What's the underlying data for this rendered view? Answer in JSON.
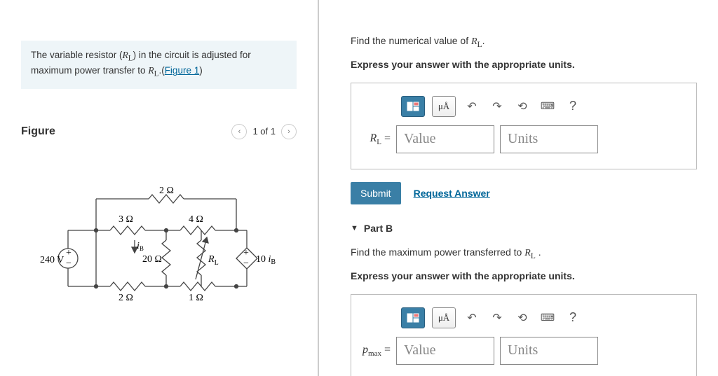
{
  "intro": {
    "text_before": "The variable resistor (",
    "rl": "R",
    "rl_sub": "L",
    "text_mid": ") in the circuit is adjusted for maximum power transfer to ",
    "rl2": "R",
    "rl2_sub": "L",
    "text_after": ".(",
    "figure_link": "Figure 1",
    "text_end": ")"
  },
  "figure": {
    "title": "Figure",
    "pager": "1 of 1"
  },
  "circuit": {
    "source": "240 V",
    "r_top": "2 Ω",
    "r_left_top": "3 Ω",
    "r_right_top": "4 Ω",
    "r_mid": "20 Ω",
    "r_rl": "R",
    "r_rl_sub": "L",
    "r_left_bot": "2 Ω",
    "r_right_bot": "1 Ω",
    "i_b": "i",
    "i_b_sub": "B",
    "ccvs": "10 ",
    "ccvs_i": "i",
    "ccvs_sub": "B"
  },
  "partA": {
    "q_prefix": "Find the numerical value of ",
    "var": "R",
    "var_sub": "L",
    "q_suffix": ".",
    "instr": "Express your answer with the appropriate units.",
    "label_var": "R",
    "label_sub": "L",
    "equals": " =",
    "placeholder_value": "Value",
    "placeholder_units": "Units",
    "submit": "Submit",
    "request": "Request Answer",
    "units_btn": "μÅ",
    "help": "?"
  },
  "partB": {
    "header": "Part B",
    "q_prefix": "Find the maximum power transferred to ",
    "var": "R",
    "var_sub": "L",
    "q_suffix": " .",
    "instr": "Express your answer with the appropriate units.",
    "label": "p",
    "label_sub": "max",
    "equals": " =",
    "placeholder_value": "Value",
    "placeholder_units": "Units",
    "units_btn": "μÅ",
    "help": "?"
  }
}
